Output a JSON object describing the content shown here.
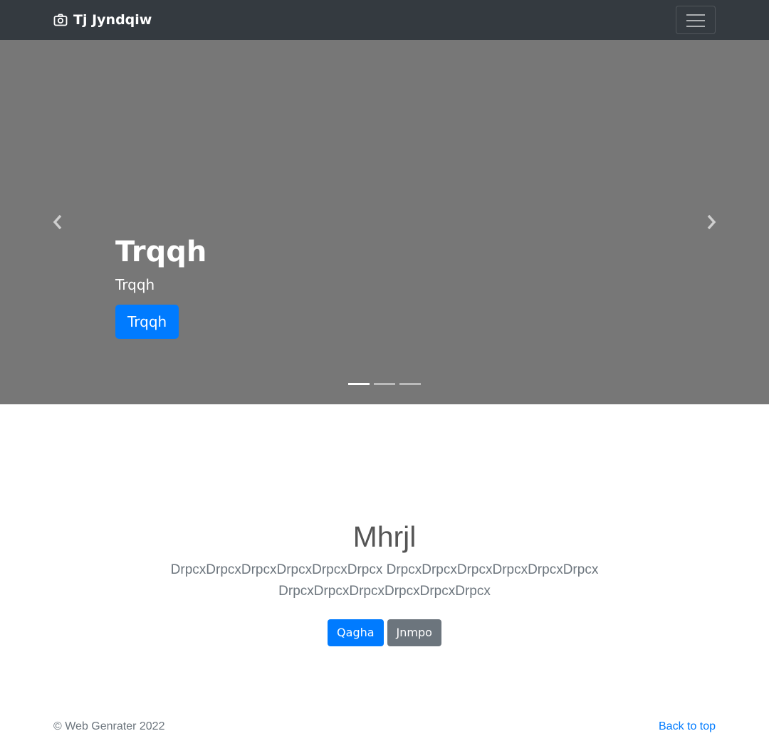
{
  "navbar": {
    "brand": "Tj Jyndqiw",
    "brand_icon": "camera-icon",
    "toggler_icon": "hamburger-icon"
  },
  "carousel": {
    "slide": {
      "heading": "Trqqh",
      "text": "Trqqh",
      "button": "Trqqh"
    },
    "prev_icon": "chevron-left-icon",
    "next_icon": "chevron-right-icon",
    "indicator_count": 3,
    "active_index": 0
  },
  "jumbotron": {
    "heading": "Mhrjl",
    "lead": "DrpcxDrpcxDrpcxDrpcxDrpcxDrpcx DrpcxDrpcxDrpcxDrpcxDrpcxDrpcx DrpcxDrpcxDrpcxDrpcxDrpcxDrpcx",
    "primary_button": "Qagha",
    "secondary_button": "Jnmpo"
  },
  "footer": {
    "copyright": "© Web Genrater 2022",
    "back_to_top": "Back to top"
  },
  "colors": {
    "navbar_bg": "#343a40",
    "carousel_bg": "#777777",
    "primary": "#007bff",
    "secondary": "#6c757d"
  }
}
